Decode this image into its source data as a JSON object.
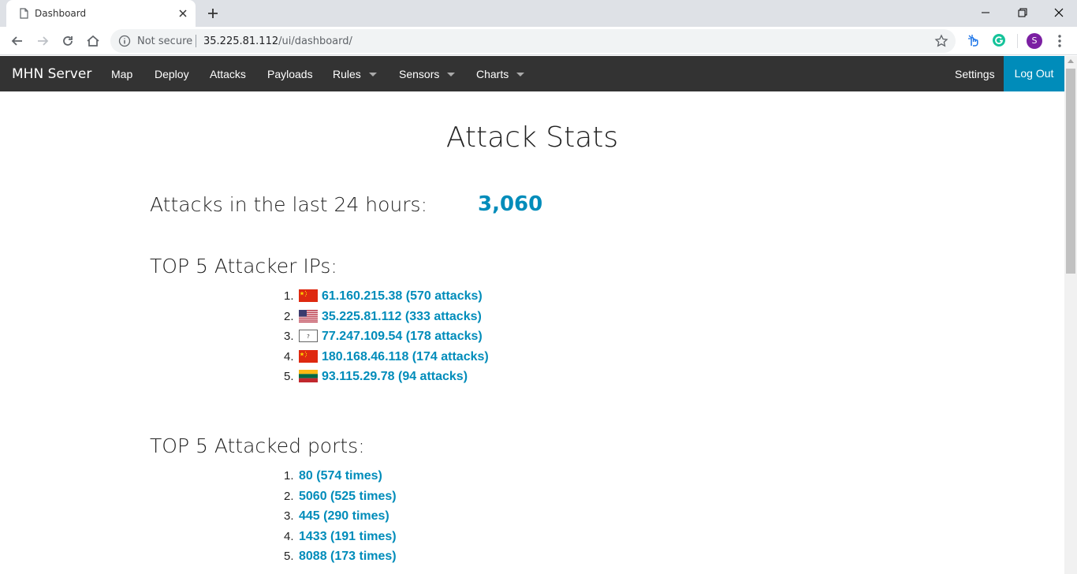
{
  "browser": {
    "tab_title": "Dashboard",
    "security_label": "Not secure",
    "url_host": "35.225.81.112",
    "url_path": "/ui/dashboard/",
    "avatar_letter": "S"
  },
  "navbar": {
    "brand": "MHN Server",
    "items": [
      {
        "label": "Map",
        "dropdown": false
      },
      {
        "label": "Deploy",
        "dropdown": false
      },
      {
        "label": "Attacks",
        "dropdown": false
      },
      {
        "label": "Payloads",
        "dropdown": false
      },
      {
        "label": "Rules",
        "dropdown": true
      },
      {
        "label": "Sensors",
        "dropdown": true
      },
      {
        "label": "Charts",
        "dropdown": true
      }
    ],
    "settings": "Settings",
    "logout": "Log Out",
    "accent_color": "#008cba"
  },
  "main": {
    "title": "Attack Stats",
    "attacks_24h_label": "Attacks in the last 24 hours:",
    "attacks_24h_value": "3,060",
    "top_ips_title": "TOP 5 Attacker IPs:",
    "top_ips": [
      {
        "num": "1.",
        "flag": "china-flag-icon",
        "text": "61.160.215.38 (570 attacks)"
      },
      {
        "num": "2.",
        "flag": "usa-flag-icon",
        "text": "35.225.81.112 (333 attacks)"
      },
      {
        "num": "3.",
        "flag": "unknown-flag-icon",
        "text": "77.247.109.54 (178 attacks)"
      },
      {
        "num": "4.",
        "flag": "china-flag-icon",
        "text": "180.168.46.118 (174 attacks)"
      },
      {
        "num": "5.",
        "flag": "lithuania-flag-icon",
        "text": "93.115.29.78 (94 attacks)"
      }
    ],
    "top_ports_title": "TOP 5 Attacked ports:",
    "top_ports": [
      {
        "num": "1.",
        "text": "80 (574 times)"
      },
      {
        "num": "2.",
        "text": "5060 (525 times)"
      },
      {
        "num": "3.",
        "text": "445 (290 times)"
      },
      {
        "num": "4.",
        "text": "1433 (191 times)"
      },
      {
        "num": "5.",
        "text": "8088 (173 times)"
      }
    ]
  }
}
